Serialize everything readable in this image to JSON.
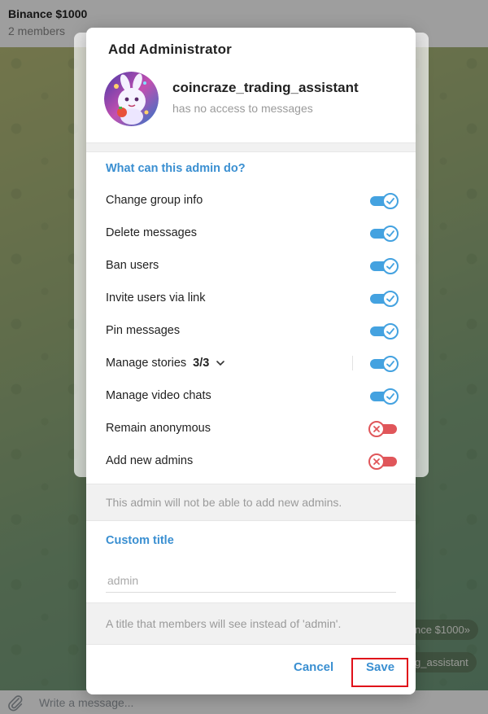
{
  "chat": {
    "title": "Binance $1000",
    "subtitle": "2 members",
    "bubble_1": "nce $1000»",
    "bubble_2": "g_assistant",
    "composer_placeholder": "Write a message..."
  },
  "dialog": {
    "title": "Add Administrator",
    "user": {
      "name": "coincraze_trading_assistant",
      "status": "has no access to messages"
    },
    "permissions_header": "What can this admin do?",
    "permissions": [
      {
        "label": "Change group info",
        "enabled": true
      },
      {
        "label": "Delete messages",
        "enabled": true
      },
      {
        "label": "Ban users",
        "enabled": true
      },
      {
        "label": "Invite users via link",
        "enabled": true
      },
      {
        "label": "Pin messages",
        "enabled": true
      },
      {
        "label": "Manage stories",
        "count": "3/3",
        "enabled": true
      },
      {
        "label": "Manage video chats",
        "enabled": true
      },
      {
        "label": "Remain anonymous",
        "enabled": false
      },
      {
        "label": "Add new admins",
        "enabled": false
      }
    ],
    "permissions_note": "This admin will not be able to add new admins.",
    "custom_title_header": "Custom title",
    "custom_title_placeholder": "admin",
    "custom_title_value": "",
    "custom_title_note": "A title that members will see instead of 'admin'.",
    "cancel_label": "Cancel",
    "save_label": "Save"
  },
  "colors": {
    "accent": "#3a8fd1",
    "toggle_on": "#44a2e0",
    "toggle_off": "#e0565a",
    "highlight": "#e0101a"
  }
}
